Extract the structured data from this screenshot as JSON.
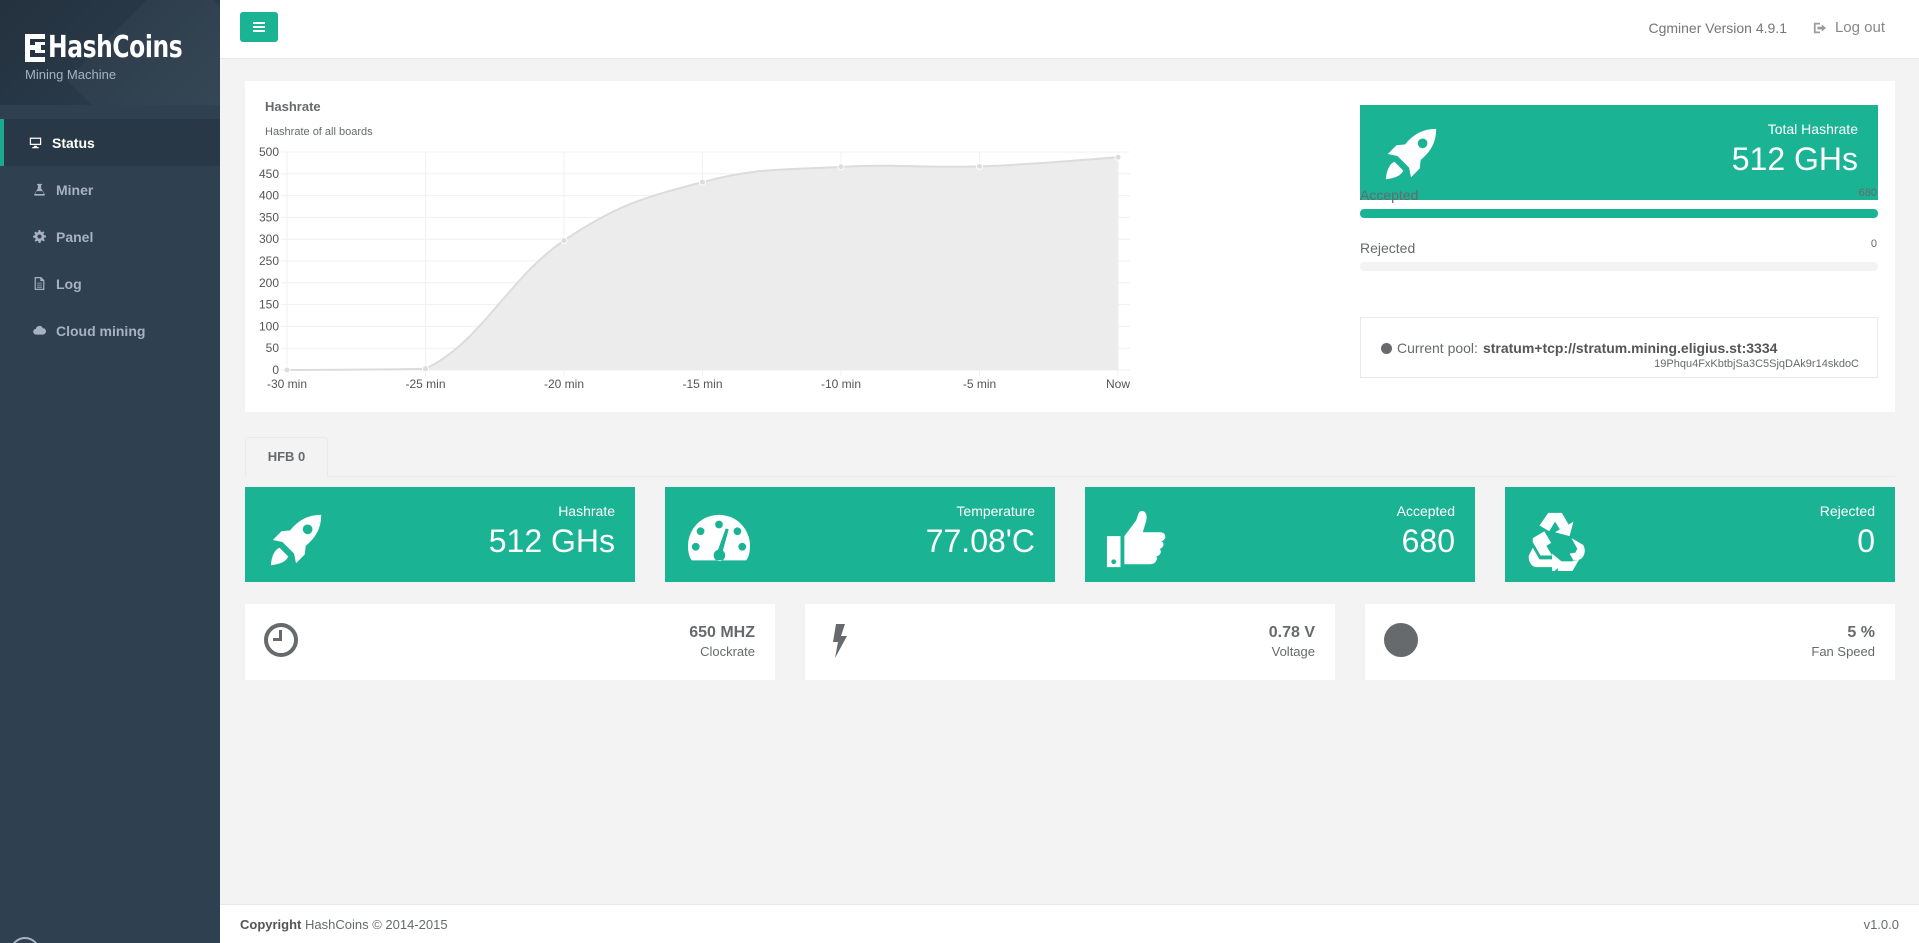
{
  "brand": {
    "name": "HashCoins",
    "subtitle": "Mining Machine"
  },
  "nav": [
    {
      "label": "Status",
      "icon": "monitor-icon",
      "active": true
    },
    {
      "label": "Miner",
      "icon": "flask-icon"
    },
    {
      "label": "Panel",
      "icon": "gear-icon"
    },
    {
      "label": "Log",
      "icon": "file-icon"
    },
    {
      "label": "Cloud mining",
      "icon": "cloud-icon"
    }
  ],
  "topbar": {
    "version": "Cgminer Version 4.9.1",
    "logout_label": "Log out"
  },
  "hashrate_panel": {
    "title": "Hashrate",
    "subtitle": "Hashrate of all boards"
  },
  "chart_data": {
    "type": "area",
    "title": "Hashrate",
    "subtitle": "Hashrate of all boards",
    "categories": [
      "-30 min",
      "-25 min",
      "-20 min",
      "-15 min",
      "-10 min",
      "-5 min",
      "Now"
    ],
    "series": [
      {
        "values": [
          0,
          3,
          297,
          431,
          466,
          467,
          488
        ]
      }
    ],
    "yticks": [
      0,
      50,
      100,
      150,
      200,
      250,
      300,
      350,
      400,
      450,
      500
    ],
    "ylim": [
      0,
      500
    ],
    "grid": true,
    "fill_color": "#ececec",
    "line_color": "#dcdcdc"
  },
  "total": {
    "label": "Total Hashrate",
    "value": "512 GHs"
  },
  "accepted": {
    "label": "Accepted",
    "value": "680",
    "fraction": 1.0
  },
  "rejected": {
    "label": "Rejected",
    "value": "0",
    "fraction": 0.0
  },
  "pool": {
    "prefix": "Current pool:",
    "url": "stratum+tcp://stratum.mining.eligius.st:3334",
    "address": "19Phqu4FxKbtbjSa3C5SjqDAk9r14skdoC"
  },
  "tabs": [
    {
      "label": "HFB 0"
    }
  ],
  "boards": [
    {
      "label": "Hashrate",
      "value": "512 GHs",
      "icon": "rocket-icon"
    },
    {
      "label": "Temperature",
      "value": "77.08'C",
      "icon": "speedometer-icon"
    },
    {
      "label": "Accepted",
      "value": "680",
      "icon": "thumbs-up-icon"
    },
    {
      "label": "Rejected",
      "value": "0",
      "icon": "recycle-icon"
    }
  ],
  "info": [
    {
      "label": "Clockrate",
      "value": "650 MHZ",
      "icon": "clock-icon"
    },
    {
      "label": "Voltage",
      "value": "0.78 V",
      "icon": "bolt-icon"
    },
    {
      "label": "Fan Speed",
      "value": "5 %",
      "icon": "circle-icon"
    }
  ],
  "footer": {
    "copyright_label": "Copyright",
    "copyright_text": " HashCoins © 2014-2015",
    "version": "v1.0.0"
  },
  "colors": {
    "accent": "#1ab394",
    "sidebar": "#2f4050",
    "text": "#676a6c"
  }
}
